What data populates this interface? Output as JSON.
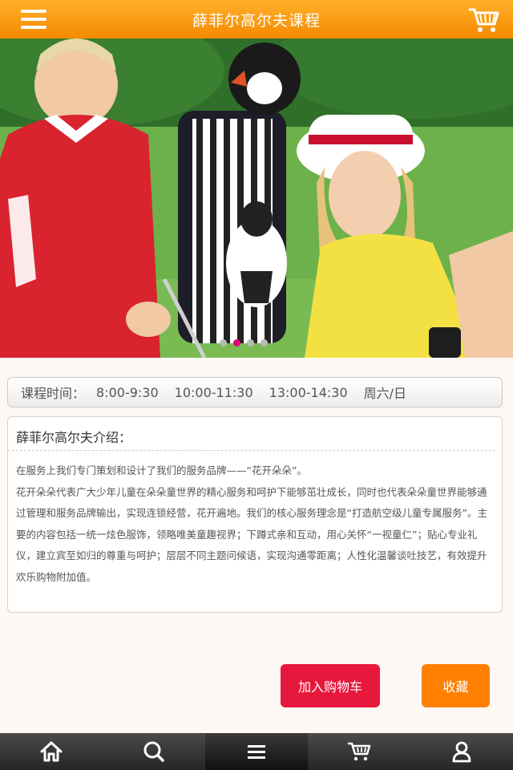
{
  "header": {
    "title": "薛菲尔高尔夫课程"
  },
  "banner": {
    "slides": 4,
    "active_index": 1,
    "colors": {
      "active_dot": "#e5007e",
      "inactive_dot": "#b9b9b9"
    }
  },
  "schedule": {
    "label": "课程时间：",
    "slots": [
      "8:00-9:30",
      "10:00-11:30",
      "13:00-14:30",
      "周六/日"
    ]
  },
  "intro": {
    "title": "薛菲尔高尔夫介绍：",
    "paragraphs": [
      "在服务上我们专门策划和设计了我们的服务品牌——“花开朵朵”。",
      "花开朵朵代表广大少年儿童在朵朵童世界的精心服务和呵护下能够茁壮成长，同时也代表朵朵童世界能够通过管理和服务品牌输出，实现连锁经营，花开遍地。我们的核心服务理念是“打造航空级儿童专属服务”。主要的内容包括一统一炫色服饰，领略唯美童趣视界；下蹲式亲和互动，用心关怀“一视童仁”；贴心专业礼仪，建立宾至如归的尊重与呵护；层层不同主题问候语，实现沟通零距离；人性化温馨谈吐技艺，有效提升欢乐购物附加值。"
    ]
  },
  "actions": {
    "add_to_cart": "加入购物车",
    "favorite": "收藏"
  },
  "bottom_nav": {
    "items": [
      "home-icon",
      "search-icon",
      "menu-icon",
      "cart-icon",
      "user-icon"
    ],
    "active_index": 2
  },
  "colors": {
    "header_orange": "#f58a00",
    "cart_button": "#e8173c",
    "favorite_button": "#ff7f00"
  }
}
